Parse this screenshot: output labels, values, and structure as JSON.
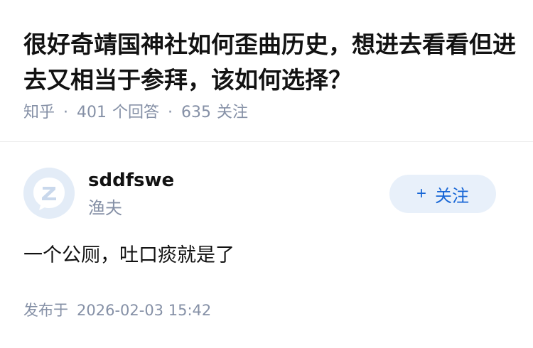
{
  "question": {
    "title": "很好奇靖国神社如何歪曲历史，想进去看看但进去又相当于参拜，该如何选择？",
    "source": "知乎",
    "separator": "·",
    "answer_count": "401",
    "answer_count_label": "个回答",
    "follower_count": "635",
    "follower_count_label": "关注"
  },
  "answer": {
    "author_name": "sddfswe",
    "author_tag": "渔夫",
    "follow_plus": "+",
    "follow_label": "关注",
    "content": "一个公厕，吐口痰就是了",
    "published_label": "发布于",
    "published_time": "2026-02-03 15:42"
  },
  "colors": {
    "accent": "#1766d6",
    "follow_bg": "#e8f0fa",
    "meta_gray": "#8590a6",
    "avatar_bg": "#e3ecf7"
  },
  "icons": {
    "avatar": "zhihu-default-avatar-icon"
  }
}
